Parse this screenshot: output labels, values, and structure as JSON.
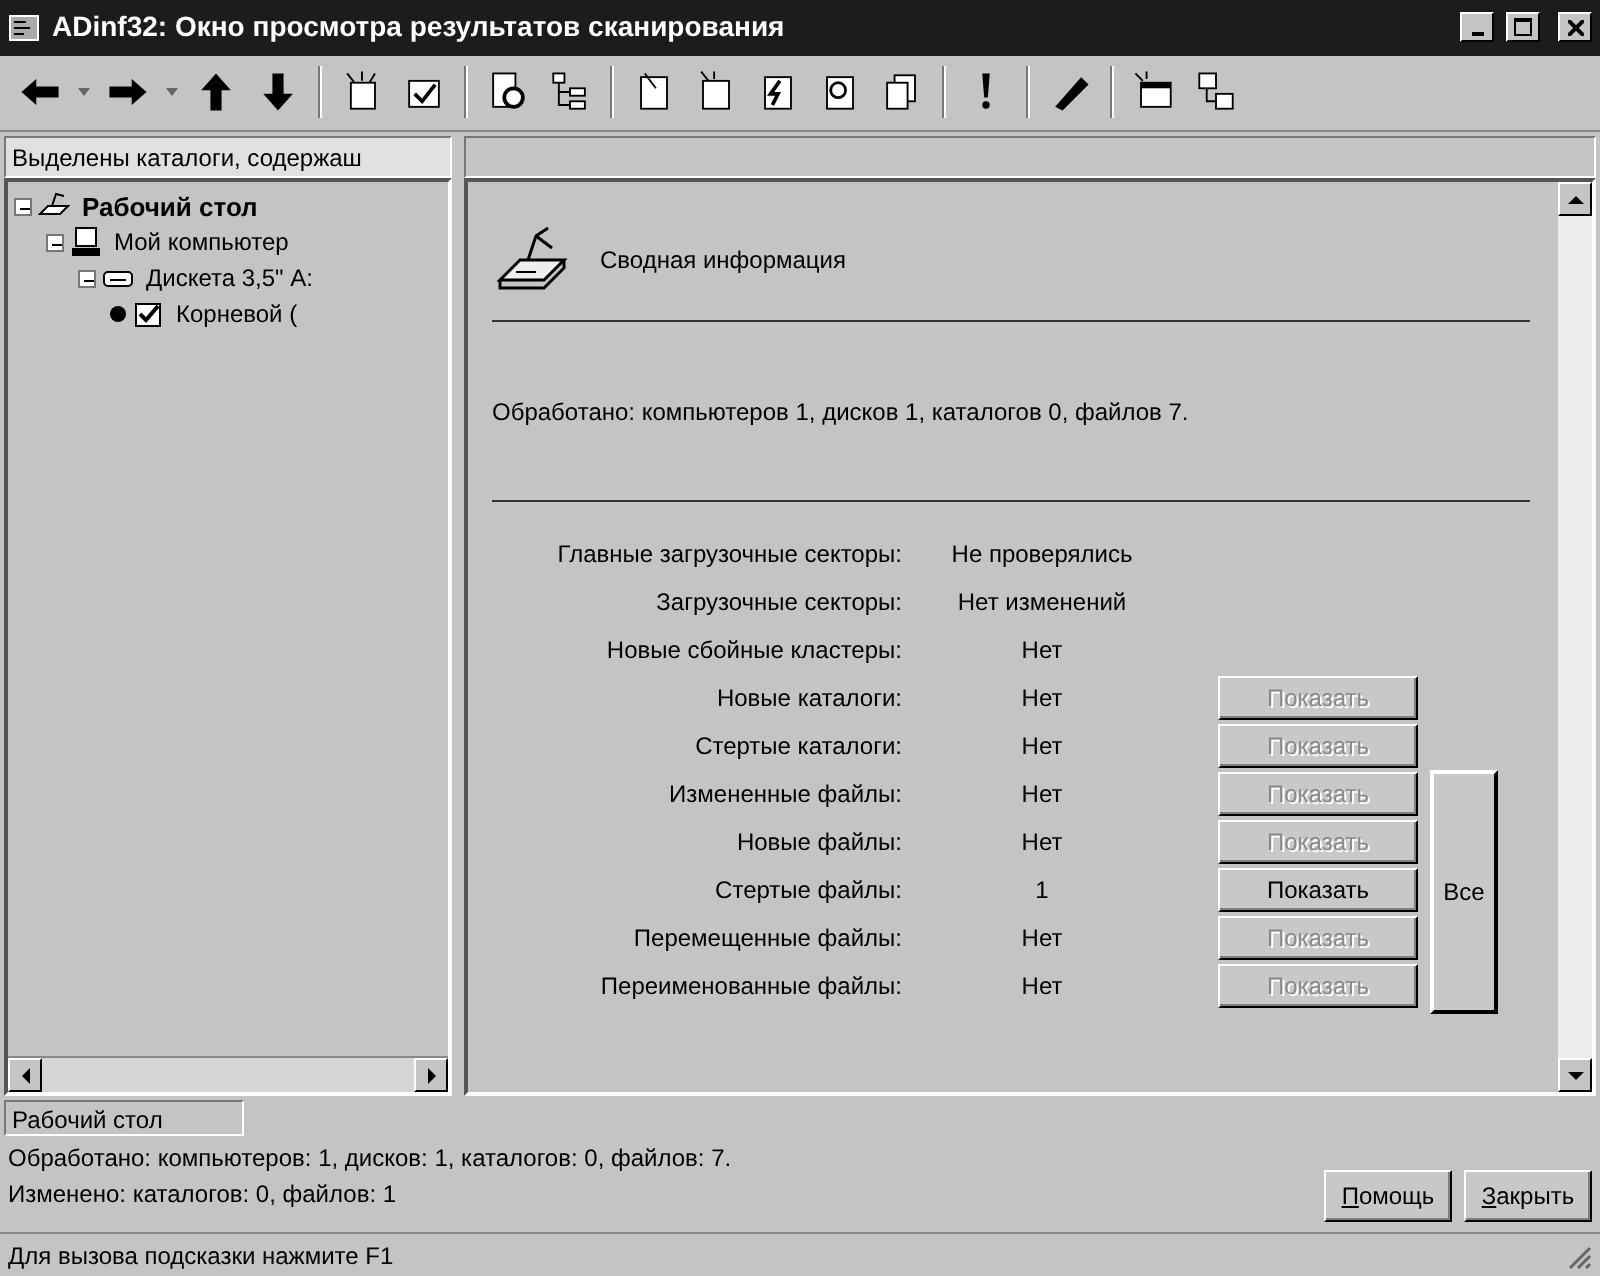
{
  "window": {
    "title": "ADinf32: Окно просмотра результатов сканирования"
  },
  "selection_label": "Выделены каталоги, содержаш",
  "tree": [
    {
      "label": "Рабочий стол",
      "kind": "desktop",
      "expanded": true,
      "children": [
        {
          "label": "Мой компьютер",
          "kind": "computer",
          "expanded": true,
          "children": [
            {
              "label": "Дискета 3,5\" A:",
              "kind": "floppy",
              "expanded": true,
              "children": [
                {
                  "label": "Корневой (",
                  "kind": "folder",
                  "marked": true
                }
              ]
            }
          ]
        }
      ]
    }
  ],
  "summary": {
    "title": "Сводная информация",
    "processed": "Обработано: компьютеров 1,  дисков 1,  каталогов 0,  файлов 7.",
    "rows": [
      {
        "label": "Главные загрузочные секторы:",
        "value": "Не проверялись"
      },
      {
        "label": "Загрузочные секторы:",
        "value": "Нет изменений"
      },
      {
        "label": "Новые сбойные кластеры:",
        "value": "Нет"
      },
      {
        "label": "Новые каталоги:",
        "value": "Нет",
        "button": {
          "label": "Показать",
          "disabled": true
        }
      },
      {
        "label": "Стертые каталоги:",
        "value": "Нет",
        "button": {
          "label": "Показать",
          "disabled": true
        }
      },
      {
        "label": "Измененные файлы:",
        "value": "Нет",
        "button": {
          "label": "Показать",
          "disabled": true
        }
      },
      {
        "label": "Новые файлы:",
        "value": "Нет",
        "button": {
          "label": "Показать",
          "disabled": true
        }
      },
      {
        "label": "Стертые файлы:",
        "value": "1",
        "button": {
          "label": "Показать",
          "disabled": false
        }
      },
      {
        "label": "Перемещенные файлы:",
        "value": "Нет",
        "button": {
          "label": "Показать",
          "disabled": true
        }
      },
      {
        "label": "Переименованные файлы:",
        "value": "Нет",
        "button": {
          "label": "Показать",
          "disabled": true
        }
      }
    ],
    "all_button": {
      "label": "Все",
      "disabled": false
    }
  },
  "location": "Рабочий стол",
  "stats": [
    "Обработано: компьютеров: 1, дисков: 1, каталогов: 0, файлов: 7.",
    "Изменено: каталогов: 0, файлов: 1"
  ],
  "buttons": [
    {
      "label": "Помощь",
      "first_letter_underlined": true
    },
    {
      "label": "Закрыть",
      "first_letter_underlined": true
    }
  ],
  "status_bar": "Для вызова подсказки нажмите F1"
}
